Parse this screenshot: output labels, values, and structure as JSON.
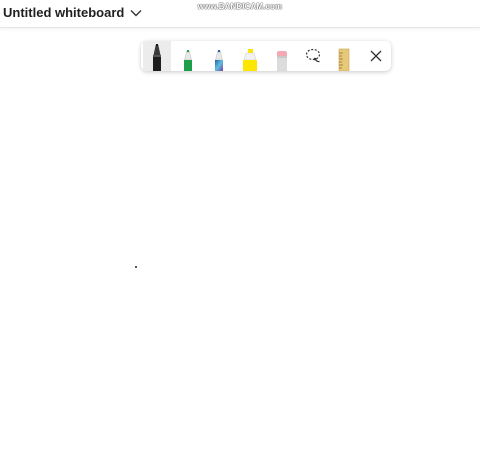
{
  "header": {
    "title": "Untitled whiteboard"
  },
  "watermark": {
    "text": "www.BANDICAM.com"
  },
  "toolbar": {
    "tools": [
      {
        "name": "Pen",
        "icon": "pen-black-icon",
        "color": "#222222",
        "selected": true
      },
      {
        "name": "Pen",
        "icon": "pen-green-icon",
        "color": "#1e9e4a"
      },
      {
        "name": "Pen",
        "icon": "pen-galaxy-icon",
        "color": "#2f5da8"
      },
      {
        "name": "Highlighter",
        "icon": "highlighter-yellow-icon",
        "color": "#ffe600"
      },
      {
        "name": "Eraser",
        "icon": "eraser-icon",
        "color": "#f4a7b4"
      },
      {
        "name": "Lasso select",
        "icon": "lasso-icon"
      },
      {
        "name": "Ruler",
        "icon": "ruler-icon",
        "color": "#e8c97a"
      },
      {
        "name": "Close",
        "icon": "close-icon"
      }
    ]
  },
  "colors": {
    "background": "#ffffff",
    "title": "#202020"
  }
}
